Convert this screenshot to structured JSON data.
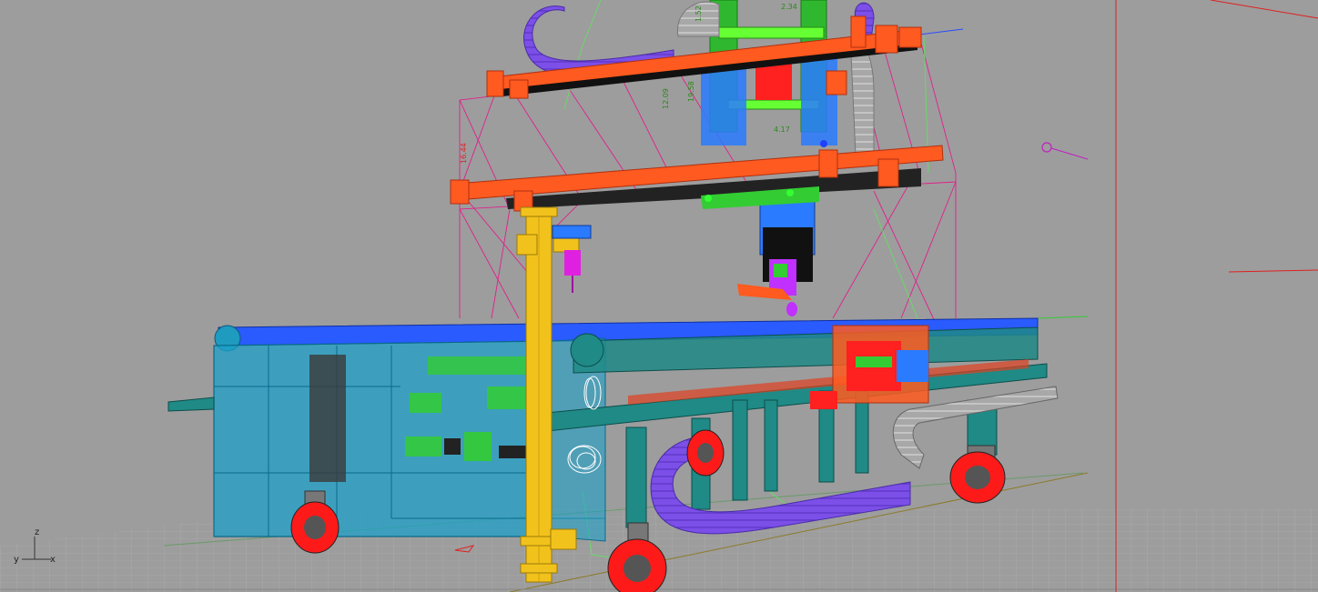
{
  "viewport": {
    "name": "Perspective",
    "background": "#9d9d9d"
  },
  "axes": {
    "z": "z",
    "y": "y",
    "x": "x"
  },
  "dimensions": [
    "12.09",
    "19.58",
    "4.17",
    "16.44",
    "2.34",
    "1.52"
  ],
  "colors": {
    "frame_orange": "#ff5a1f",
    "frame_red": "#ff2020",
    "cable_chain": "#7b4fe8",
    "column_yellow": "#f2c21c",
    "cabinet_cyan": "#1ea0c8",
    "rail_teal": "#1f8a86",
    "wheel_red": "#ff1a1a",
    "wire_magenta": "#e0208c",
    "carriage_green": "#33cc33",
    "carriage_blue": "#2a7bff",
    "ground_grid": "#b8b8b8"
  }
}
